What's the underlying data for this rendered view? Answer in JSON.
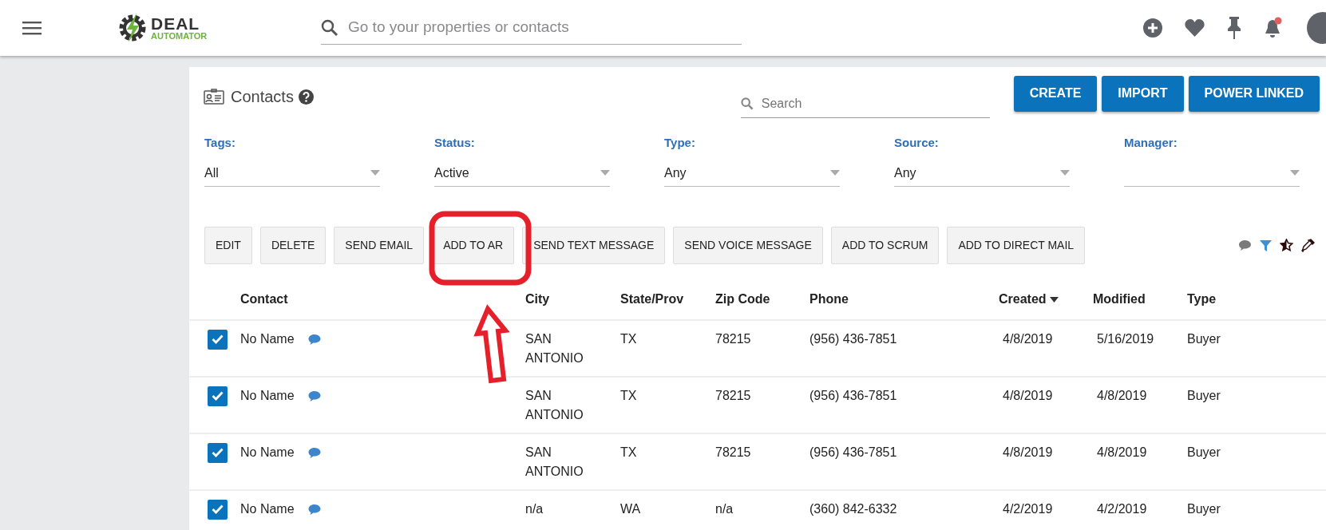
{
  "header": {
    "logo": {
      "line1": "DEAL",
      "line2": "AUTOMATOR"
    },
    "search_placeholder": "Go to your properties or contacts",
    "notifications_unread": true
  },
  "page": {
    "title": "Contacts",
    "search_placeholder": "Search",
    "buttons": [
      "CREATE",
      "IMPORT",
      "POWER LINKED"
    ]
  },
  "filters": [
    {
      "label": "Tags:",
      "value": "All"
    },
    {
      "label": "Status:",
      "value": "Active"
    },
    {
      "label": "Type:",
      "value": "Any"
    },
    {
      "label": "Source:",
      "value": "Any"
    },
    {
      "label": "Manager:"
    }
  ],
  "actions": [
    "EDIT",
    "DELETE",
    "SEND EMAIL",
    "ADD TO AR",
    "SEND TEXT MESSAGE",
    "SEND VOICE MESSAGE",
    "ADD TO SCRUM",
    "ADD TO DIRECT MAIL"
  ],
  "table": {
    "columns": [
      {
        "label": "Contact",
        "sorted": false
      },
      {
        "label": "City",
        "sorted": false
      },
      {
        "label": "State/Prov",
        "sorted": false
      },
      {
        "label": "Zip Code",
        "sorted": false
      },
      {
        "label": "Phone",
        "sorted": false
      },
      {
        "label": "Created",
        "sorted": true
      },
      {
        "label": "Modified",
        "sorted": false
      },
      {
        "label": "Type",
        "sorted": false
      }
    ],
    "rows": [
      {
        "checked": true,
        "cells": [
          "No Name",
          "SAN ANTONIO",
          "TX",
          "78215",
          "(956) 436-7851",
          "4/8/2019",
          "5/16/2019",
          "Buyer"
        ]
      },
      {
        "checked": true,
        "cells": [
          "No Name",
          "SAN ANTONIO",
          "TX",
          "78215",
          "(956) 436-7851",
          "4/8/2019",
          "4/8/2019",
          "Buyer"
        ]
      },
      {
        "checked": true,
        "cells": [
          "No Name",
          "SAN ANTONIO",
          "TX",
          "78215",
          "(956) 436-7851",
          "4/8/2019",
          "4/8/2019",
          "Buyer"
        ]
      },
      {
        "checked": true,
        "cells": [
          "No Name",
          "n/a",
          "WA",
          "n/a",
          "(360) 842-6332",
          "4/2/2019",
          "4/2/2019",
          "Buyer"
        ]
      }
    ]
  }
}
